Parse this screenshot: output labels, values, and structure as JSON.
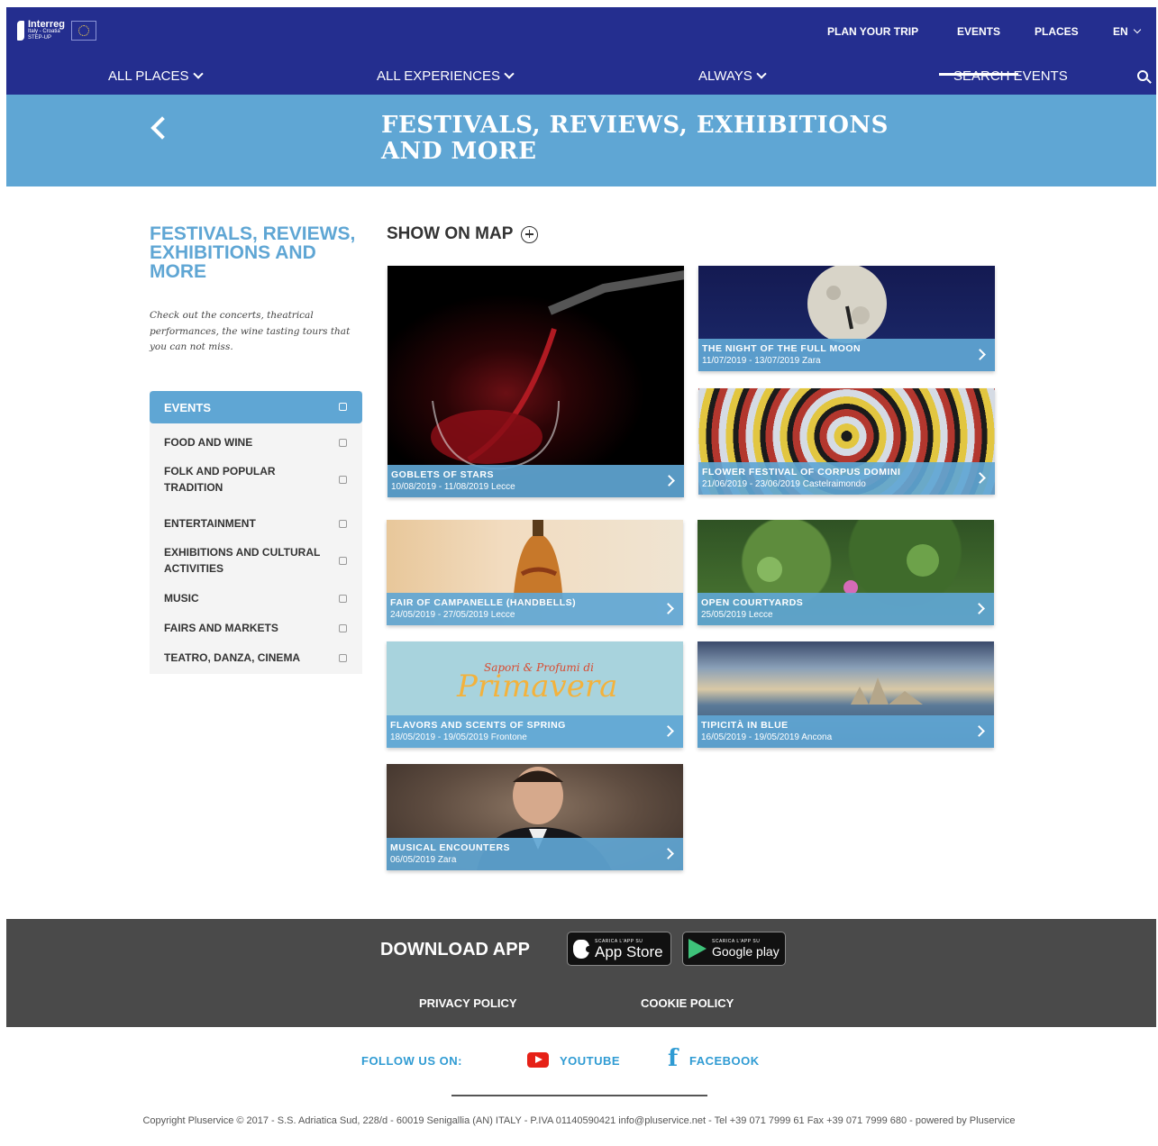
{
  "brand": {
    "name": "Interreg",
    "sub1": "Italy - Croatia",
    "sub2": "STEP-UP"
  },
  "nav": {
    "plan_trip": "PLAN YOUR TRIP",
    "events": "EVENTS",
    "places": "PLACES",
    "lang": "EN"
  },
  "subnav": {
    "places": "ALL PLACES",
    "experiences": "ALL EXPERIENCES",
    "time": "ALWAYS",
    "search": "SEARCH EVENTS"
  },
  "hero": {
    "title": "FESTIVALS, REVIEWS, EXHIBITIONS AND MORE"
  },
  "sidebar": {
    "title": "FESTIVALS, REVIEWS, EXHIBITIONS AND MORE",
    "description": "Check out the concerts, theatrical performances, the wine tasting tours that you can not miss.",
    "filter_head": "EVENTS",
    "filters": [
      {
        "label": "FOOD AND WINE"
      },
      {
        "label": "FOLK AND POPULAR TRADITION"
      },
      {
        "label": "ENTERTAINMENT"
      },
      {
        "label": "EXHIBITIONS AND CULTURAL ACTIVITIES"
      },
      {
        "label": "MUSIC"
      },
      {
        "label": "FAIRS AND MARKETS"
      },
      {
        "label": "TEATRO, DANZA, CINEMA"
      }
    ]
  },
  "main": {
    "show_on_map": "SHOW ON MAP"
  },
  "events": [
    {
      "title": "GOBLETS OF STARS",
      "meta": "10/08/2019 - 11/08/2019 Lecce"
    },
    {
      "title": "THE NIGHT OF THE FULL MOON",
      "meta": "11/07/2019 - 13/07/2019 Zara"
    },
    {
      "title": "FLOWER FESTIVAL OF CORPUS DOMINI",
      "meta": "21/06/2019 - 23/06/2019 Castelraimondo"
    },
    {
      "title": "FAIR OF CAMPANELLE (HANDBELLS)",
      "meta": "24/05/2019 - 27/05/2019 Lecce"
    },
    {
      "title": "OPEN COURTYARDS",
      "meta": "25/05/2019 Lecce"
    },
    {
      "title": "FLAVORS AND SCENTS OF SPRING",
      "meta": "18/05/2019 - 19/05/2019 Frontone",
      "img_text1": "Sapori & Profumi di",
      "img_text2": "Primavera"
    },
    {
      "title": "TIPICITÀ IN BLUE",
      "meta": "16/05/2019 - 19/05/2019 Ancona"
    },
    {
      "title": "MUSICAL ENCOUNTERS",
      "meta": "06/05/2019 Zara"
    }
  ],
  "footer": {
    "download_app": "DOWNLOAD APP",
    "appstore_small": "SCARICA L'APP SU",
    "appstore_big": "App Store",
    "gplay_small": "SCARICA L'APP SU",
    "gplay_big": "Google play",
    "privacy": "PRIVACY POLICY",
    "cookie": "COOKIE POLICY",
    "follow": "FOLLOW US ON:",
    "youtube": "YOUTUBE",
    "facebook": "FACEBOOK",
    "copyright": "Copyright Pluservice © 2017 - S.S. Adriatica Sud, 228/d - 60019 Senigallia (AN) ITALY - P.IVA 01140590421 info@pluservice.net - Tel +39 071 7999 61 Fax +39 071 7999 680 - powered by Pluservice"
  },
  "colors": {
    "nav": "#242e8f",
    "accent": "#5fa6d4",
    "footer": "#4a4a4a",
    "social": "#2f9bd3"
  }
}
